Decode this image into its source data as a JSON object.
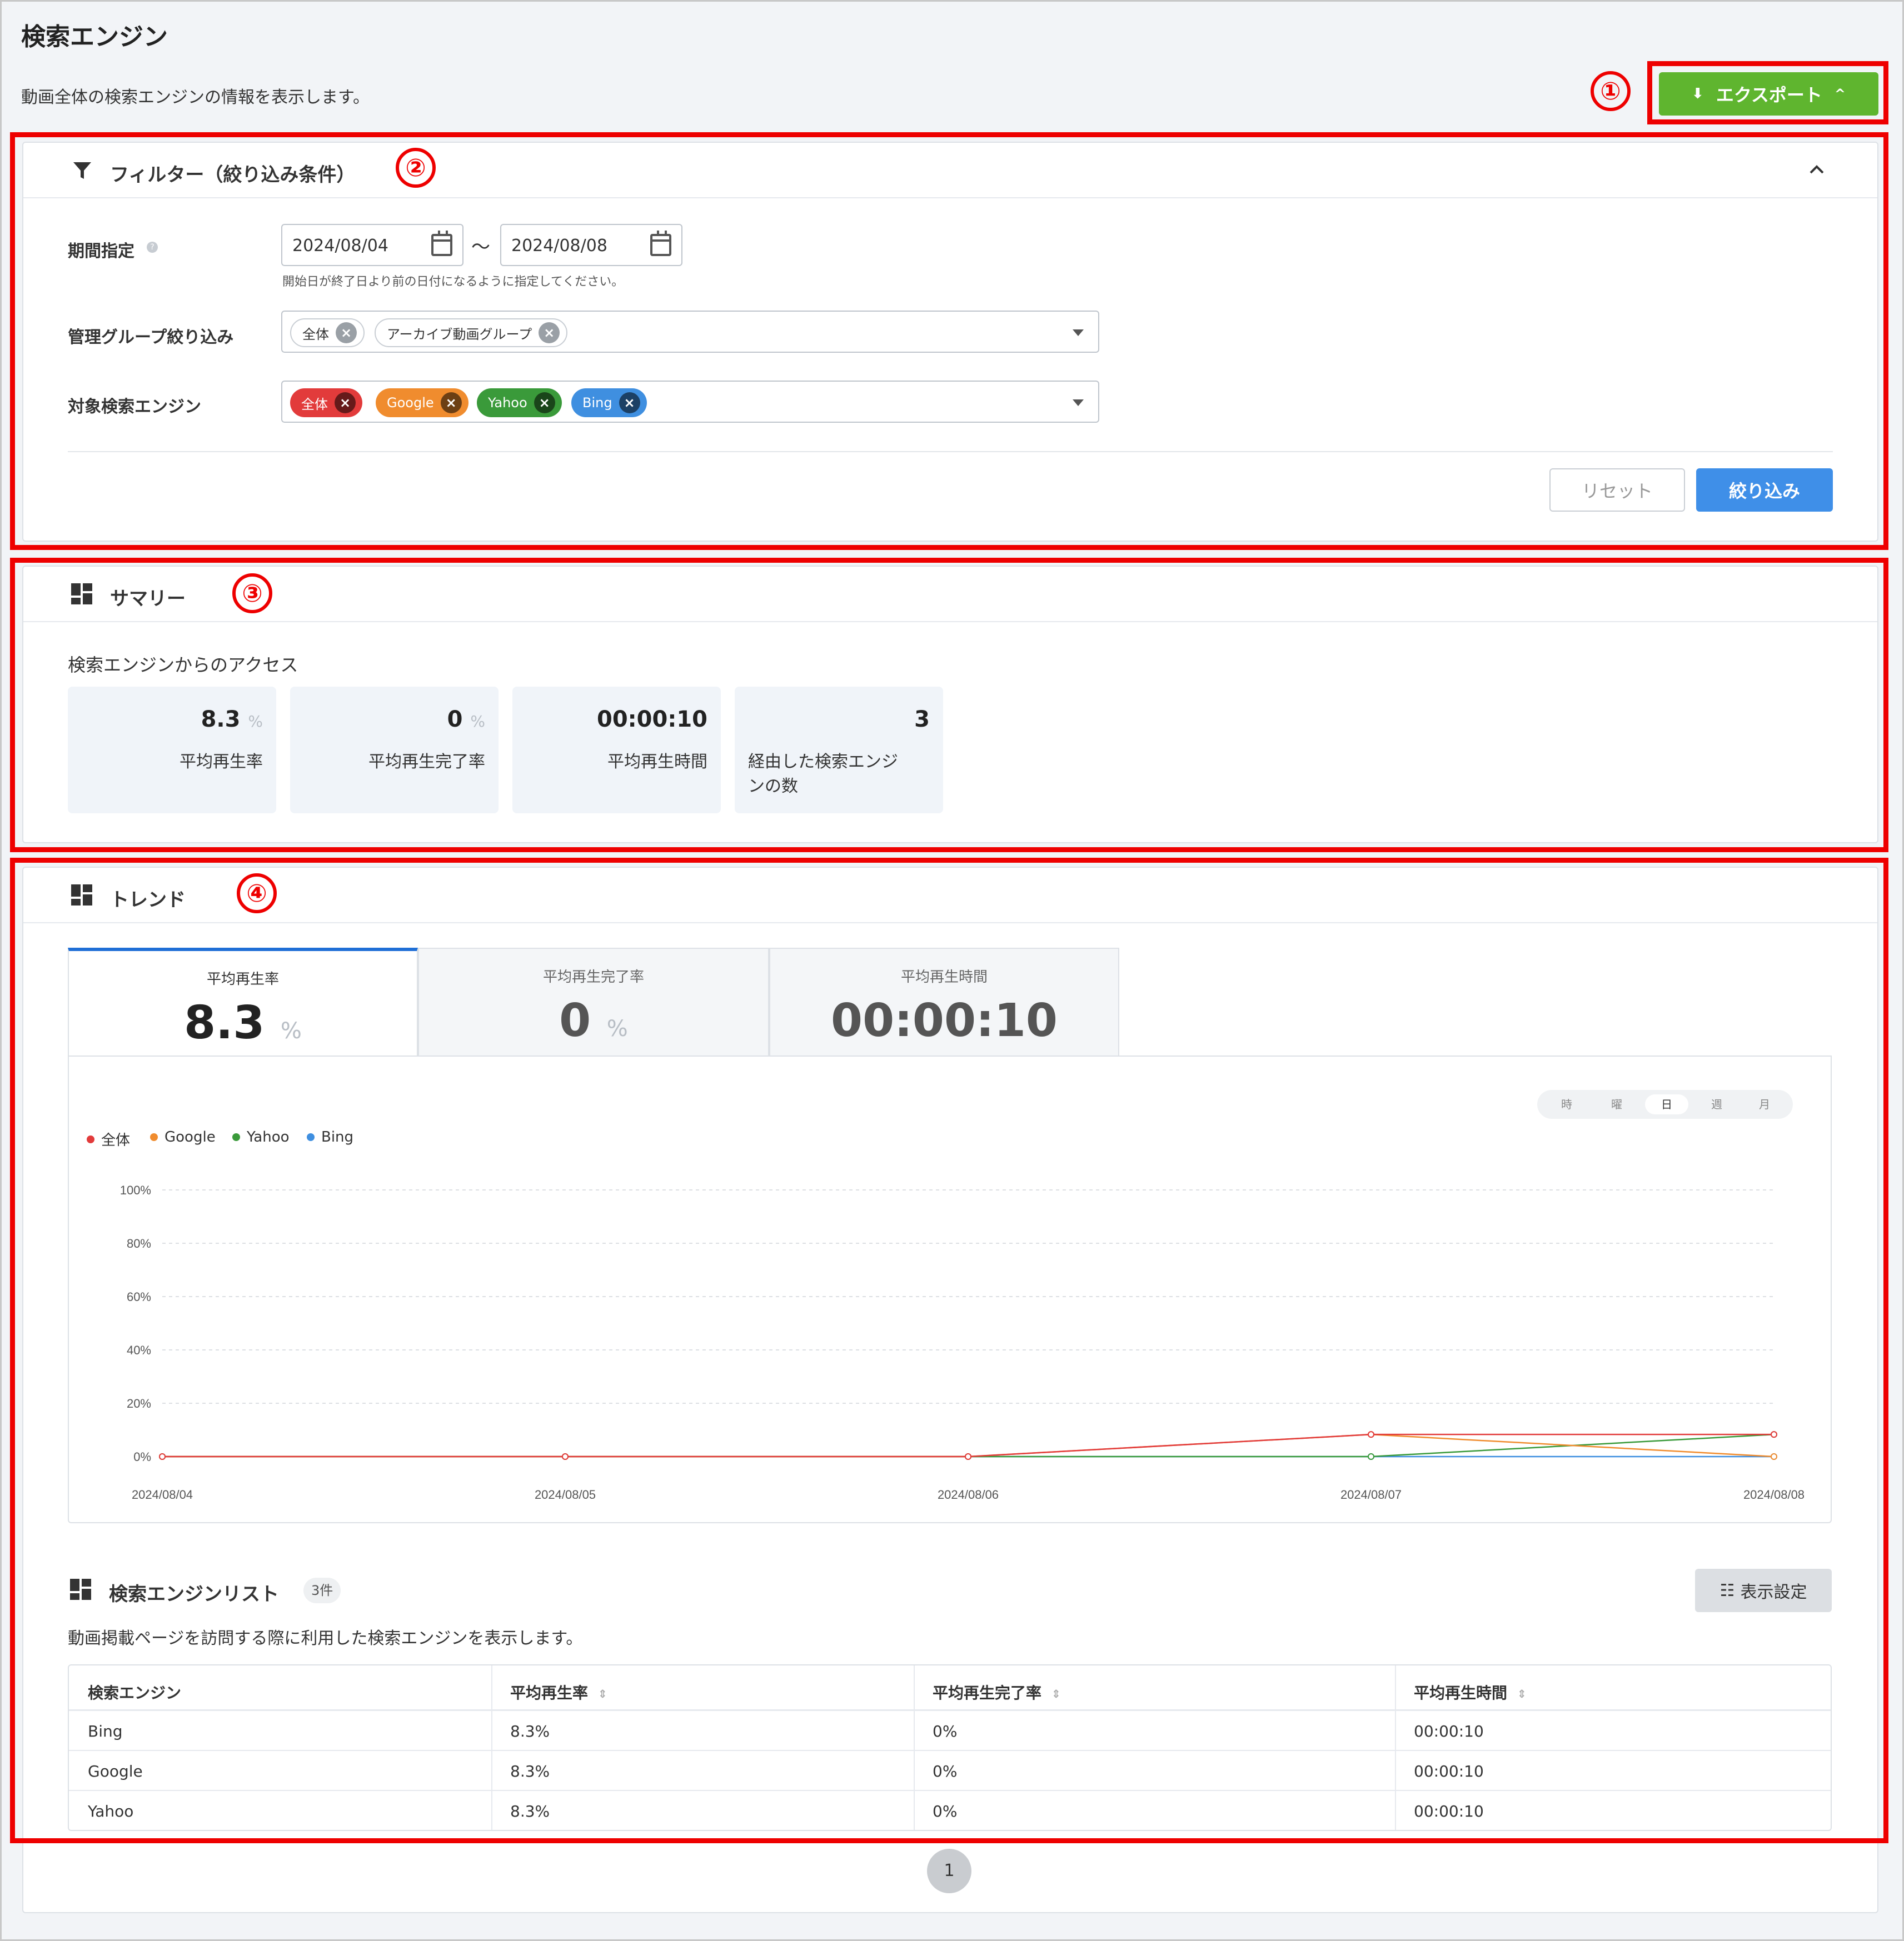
{
  "page": {
    "title": "検索エンジン",
    "description": "動画全体の検索エンジンの情報を表示します。",
    "export_label": "エクスポート"
  },
  "markers": [
    "①",
    "②",
    "③",
    "④"
  ],
  "filter": {
    "title": "フィルター（絞り込み条件）",
    "period_label": "期間指定",
    "date_from": "2024/08/04",
    "date_to": "2024/08/08",
    "tilde": "〜",
    "period_hint": "開始日が終了日より前の日付になるように指定してください。",
    "group_label": "管理グループ絞り込み",
    "group_chips": [
      "全体",
      "アーカイブ動画グループ"
    ],
    "engine_label": "対象検索エンジン",
    "engine_chips": [
      {
        "label": "全体",
        "color": "#e23b3b"
      },
      {
        "label": "Google",
        "color": "#f08c2e"
      },
      {
        "label": "Yahoo",
        "color": "#3a9a3a"
      },
      {
        "label": "Bing",
        "color": "#3f8fe0"
      }
    ],
    "reset_label": "リセット",
    "apply_label": "絞り込み"
  },
  "summary": {
    "title": "サマリー",
    "subtitle": "検索エンジンからのアクセス",
    "stats": [
      {
        "value": "8.3",
        "unit": "%",
        "label": "平均再生率"
      },
      {
        "value": "0",
        "unit": "%",
        "label": "平均再生完了率"
      },
      {
        "value": "00:00:10",
        "unit": "",
        "label": "平均再生時間"
      },
      {
        "value": "3",
        "unit": "",
        "label": "経由した検索エンジ\nンの数"
      }
    ]
  },
  "trend": {
    "title": "トレンド",
    "tabs": [
      {
        "label": "平均再生率",
        "value": "8.3",
        "unit": "%"
      },
      {
        "label": "平均再生完了率",
        "value": "0",
        "unit": "%"
      },
      {
        "label": "平均再生時間",
        "value": "00:00:10",
        "unit": ""
      }
    ],
    "granularity": [
      "時",
      "曜",
      "日",
      "週",
      "月"
    ],
    "granularity_selected": "日"
  },
  "chart_data": {
    "type": "line",
    "x": [
      "2024/08/04",
      "2024/08/05",
      "2024/08/06",
      "2024/08/07",
      "2024/08/08"
    ],
    "ylim": [
      0,
      100
    ],
    "yticks": [
      "0%",
      "20%",
      "40%",
      "60%",
      "80%",
      "100%"
    ],
    "grid": true,
    "legend_position": "top-left",
    "series": [
      {
        "name": "全体",
        "color": "#e23b3b",
        "values": [
          0,
          0,
          0,
          8.3,
          8.3
        ]
      },
      {
        "name": "Google",
        "color": "#f08c2e",
        "values": [
          0,
          0,
          0,
          8.3,
          0
        ]
      },
      {
        "name": "Yahoo",
        "color": "#3a9a3a",
        "values": [
          0,
          0,
          0,
          0,
          8.3
        ]
      },
      {
        "name": "Bing",
        "color": "#3f8fe0",
        "values": [
          0,
          0,
          0,
          0,
          0
        ]
      }
    ]
  },
  "engine_list": {
    "title": "検索エンジンリスト",
    "count": "3件",
    "display_settings": "表示設定",
    "description": "動画掲載ページを訪問する際に利用した検索エンジンを表示します。",
    "columns": [
      "検索エンジン",
      "平均再生率",
      "平均再生完了率",
      "平均再生時間"
    ],
    "rows": [
      [
        "Bing",
        "8.3%",
        "0%",
        "00:00:10"
      ],
      [
        "Google",
        "8.3%",
        "0%",
        "00:00:10"
      ],
      [
        "Yahoo",
        "8.3%",
        "0%",
        "00:00:10"
      ]
    ],
    "page": "1"
  }
}
